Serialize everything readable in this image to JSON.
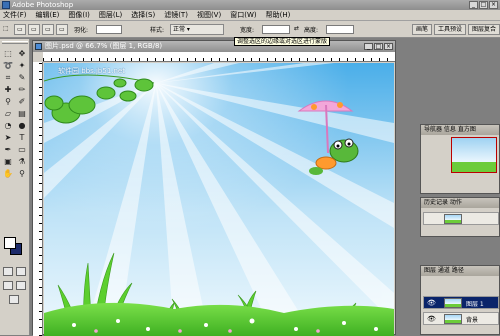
{
  "app": {
    "title": "Adobe Photoshop"
  },
  "menu": {
    "items": [
      "文件(F)",
      "编辑(E)",
      "图像(I)",
      "图层(L)",
      "选择(S)",
      "滤镜(T)",
      "视图(V)",
      "窗口(W)",
      "帮助(H)"
    ]
  },
  "options": {
    "label_feather": "羽化:",
    "label_style": "样式:",
    "style_value": "正常",
    "label_width": "宽度:",
    "label_height": "高度:",
    "right_tabs": [
      "画笔",
      "工具预设",
      "图层复合"
    ]
  },
  "tooltip": "调整选区的边缘或对选区进行蒙版",
  "document": {
    "title": "图片.psd @ 66.7% (图层 1, RGB/8)"
  },
  "canvas": {
    "watermark": "软件园 bbs.jb51.net"
  },
  "panels": {
    "navigator_title": "导航器  信息  直方图",
    "history_title": "历史记录  动作",
    "layers_title": "图层  通道  路径",
    "layers": [
      {
        "name": "图层 1",
        "selected": true
      },
      {
        "name": "背景",
        "selected": false
      }
    ]
  },
  "colors": {
    "accent": "#0a246a",
    "sky": "#4fb0ea",
    "grass": "#58c92f"
  }
}
